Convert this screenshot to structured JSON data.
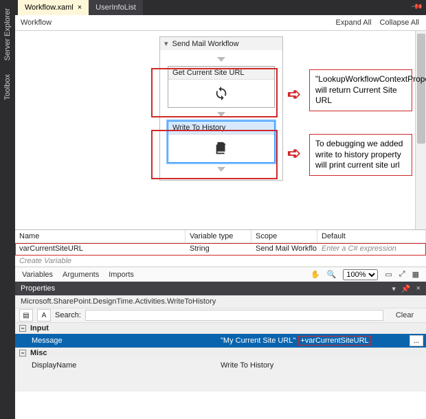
{
  "side_rails": {
    "server_explorer": "Server Explorer",
    "toolbox": "Toolbox"
  },
  "doc_tabs": {
    "active": {
      "label": "Workflow.xaml",
      "close": "×"
    },
    "inactive": {
      "label": "UserInfoList"
    },
    "pin": "📌"
  },
  "breadcrumb": {
    "root": "Workflow",
    "expand": "Expand All",
    "collapse": "Collapse All"
  },
  "workflow": {
    "container_title": "Send Mail Workflow",
    "act1_title": "Get Current Site URL",
    "act2_title": "Write To History"
  },
  "annotations": {
    "a1": "\"LookupWorkflowContextProperty\" will return Current Site URL",
    "a2": "To debugging we added write to history property will print current site url"
  },
  "vars": {
    "hdr_name": "Name",
    "hdr_type": "Variable type",
    "hdr_scope": "Scope",
    "hdr_default": "Default",
    "row_name": "varCurrentSiteURL",
    "row_type": "String",
    "row_scope": "Send Mail Workflow",
    "row_default": "Enter a C# expression",
    "create": "Create Variable"
  },
  "bottom_tabs": {
    "variables": "Variables",
    "arguments": "Arguments",
    "imports": "Imports"
  },
  "zoom": {
    "value": "100%"
  },
  "props": {
    "title": "Properties",
    "subtitle": "Microsoft.SharePoint.DesignTime.Activities.WriteToHistory",
    "search_label": "Search:",
    "clear": "Clear",
    "cat_input": "Input",
    "msg_name": "Message",
    "msg_val1": "\"My Current Site URL\"",
    "msg_val2": "+varCurrentSiteURL",
    "cat_misc": "Misc",
    "disp_name": "DisplayName",
    "disp_val": "Write To History",
    "dots": "..."
  }
}
